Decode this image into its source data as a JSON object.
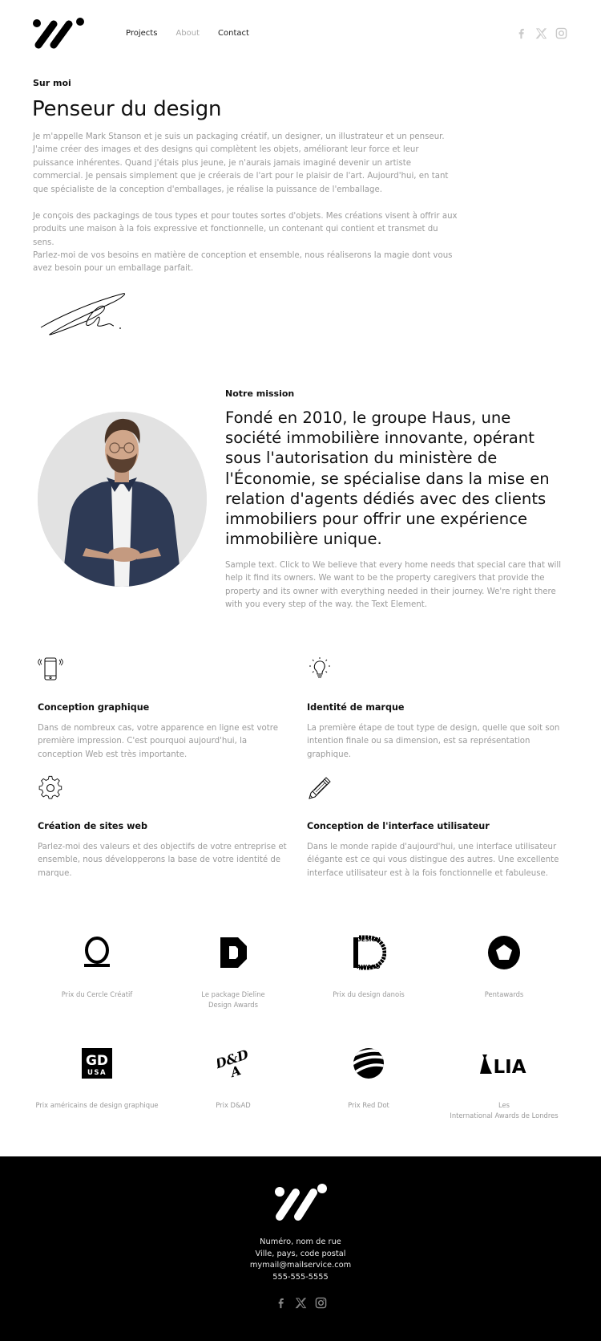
{
  "header": {
    "nav": [
      {
        "label": "Projects",
        "active": false
      },
      {
        "label": "About",
        "active": true
      },
      {
        "label": "Contact",
        "active": false
      }
    ],
    "social": [
      "facebook-icon",
      "x-icon",
      "instagram-icon"
    ]
  },
  "about": {
    "label": "Sur moi",
    "title": "Penseur du design",
    "paragraphs": [
      "Je m'appelle Mark Stanson et je suis un packaging créatif, un designer, un illustrateur et un penseur. J'aime créer des images et des designs qui complètent les objets, améliorant leur force et leur puissance inhérentes. Quand j'étais plus jeune, je n'aurais jamais imaginé devenir un artiste commercial. Je pensais simplement que je créerais de l'art pour le plaisir de l'art. Aujourd'hui, en tant que spécialiste de la conception d'emballages, je réalise la puissance de l'emballage.",
      "Je conçois des packagings de tous types et pour toutes sortes d'objets. Mes créations visent à offrir aux produits une maison à la fois expressive et fonctionnelle, un contenant qui contient et transmet du sens.",
      "Parlez-moi de vos besoins en matière de conception et ensemble, nous réaliserons la magie dont vous avez besoin pour un emballage parfait."
    ]
  },
  "mission": {
    "label": "Notre mission",
    "title": "Fondé en 2010, le groupe Haus, une société immobilière innovante, opérant sous l'autorisation du ministère de l'Économie, se spécialise dans la mise en relation d'agents dédiés avec des clients immobiliers pour offrir une expérience immobilière unique.",
    "text": "Sample text. Click to We believe that every home needs that special care that will help it find its owners. We want to be the property caregivers that provide the property and its owner with everything needed in their journey. We're right there with you every step of the way. the Text Element."
  },
  "features": [
    {
      "icon": "smartphone-icon",
      "title": "Conception graphique",
      "text": "Dans de nombreux cas, votre apparence en ligne est votre première impression. C'est pourquoi aujourd'hui, la conception Web est très importante."
    },
    {
      "icon": "lightbulb-icon",
      "title": "Identité de marque",
      "text": "La première étape de tout type de design, quelle que soit son intention finale ou sa dimension, est sa représentation graphique."
    },
    {
      "icon": "gear-icon",
      "title": "Création de sites web",
      "text": "Parlez-moi des valeurs et des objectifs de votre entreprise et ensemble, nous développerons la base de votre identité de marque."
    },
    {
      "icon": "pencil-icon",
      "title": "Conception de l'interface utilisateur",
      "text": "Dans le monde rapide d'aujourd'hui, une interface utilisateur élégante est ce qui vous distingue des autres. Une excellente interface utilisateur est à la fois fonctionnelle et fabuleuse."
    }
  ],
  "awards": [
    {
      "label": "Prix du Cercle Créatif"
    },
    {
      "label": "Le package Dieline\nDesign Awards"
    },
    {
      "label": "Prix du design danois",
      "logo_text": "DANISH DESIGN AWARD"
    },
    {
      "label": "Pentawards"
    },
    {
      "label": "Prix américains de design graphique",
      "logo_text_top": "GD",
      "logo_text_bottom": "USA"
    },
    {
      "label": "Prix D&AD"
    },
    {
      "label": "Prix Red Dot"
    },
    {
      "label": "Les\nInternational Awards de Londres",
      "logo_text": "LIA"
    }
  ],
  "footer": {
    "address_line1": "Numéro, nom de rue",
    "address_line2": "Ville, pays, code postal",
    "email": "mymail@mailservice.com",
    "phone": "555-555-5555",
    "social": [
      "facebook-icon",
      "x-icon",
      "instagram-icon"
    ]
  },
  "colors": {
    "text_primary": "#111111",
    "text_muted": "#9a9a9a",
    "nav_active": "#aaaaaa",
    "footer_bg": "#000000",
    "portrait_bg": "#e2e2e2"
  }
}
